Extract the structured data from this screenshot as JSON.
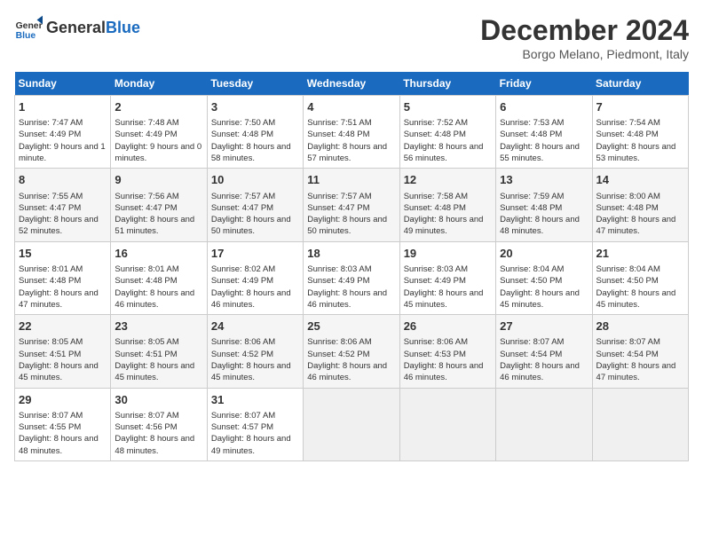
{
  "header": {
    "logo_general": "General",
    "logo_blue": "Blue",
    "month_title": "December 2024",
    "location": "Borgo Melano, Piedmont, Italy"
  },
  "weekdays": [
    "Sunday",
    "Monday",
    "Tuesday",
    "Wednesday",
    "Thursday",
    "Friday",
    "Saturday"
  ],
  "weeks": [
    [
      {
        "day": "1",
        "info": "Sunrise: 7:47 AM\nSunset: 4:49 PM\nDaylight: 9 hours and 1 minute."
      },
      {
        "day": "2",
        "info": "Sunrise: 7:48 AM\nSunset: 4:49 PM\nDaylight: 9 hours and 0 minutes."
      },
      {
        "day": "3",
        "info": "Sunrise: 7:50 AM\nSunset: 4:48 PM\nDaylight: 8 hours and 58 minutes."
      },
      {
        "day": "4",
        "info": "Sunrise: 7:51 AM\nSunset: 4:48 PM\nDaylight: 8 hours and 57 minutes."
      },
      {
        "day": "5",
        "info": "Sunrise: 7:52 AM\nSunset: 4:48 PM\nDaylight: 8 hours and 56 minutes."
      },
      {
        "day": "6",
        "info": "Sunrise: 7:53 AM\nSunset: 4:48 PM\nDaylight: 8 hours and 55 minutes."
      },
      {
        "day": "7",
        "info": "Sunrise: 7:54 AM\nSunset: 4:48 PM\nDaylight: 8 hours and 53 minutes."
      }
    ],
    [
      {
        "day": "8",
        "info": "Sunrise: 7:55 AM\nSunset: 4:47 PM\nDaylight: 8 hours and 52 minutes."
      },
      {
        "day": "9",
        "info": "Sunrise: 7:56 AM\nSunset: 4:47 PM\nDaylight: 8 hours and 51 minutes."
      },
      {
        "day": "10",
        "info": "Sunrise: 7:57 AM\nSunset: 4:47 PM\nDaylight: 8 hours and 50 minutes."
      },
      {
        "day": "11",
        "info": "Sunrise: 7:57 AM\nSunset: 4:47 PM\nDaylight: 8 hours and 50 minutes."
      },
      {
        "day": "12",
        "info": "Sunrise: 7:58 AM\nSunset: 4:48 PM\nDaylight: 8 hours and 49 minutes."
      },
      {
        "day": "13",
        "info": "Sunrise: 7:59 AM\nSunset: 4:48 PM\nDaylight: 8 hours and 48 minutes."
      },
      {
        "day": "14",
        "info": "Sunrise: 8:00 AM\nSunset: 4:48 PM\nDaylight: 8 hours and 47 minutes."
      }
    ],
    [
      {
        "day": "15",
        "info": "Sunrise: 8:01 AM\nSunset: 4:48 PM\nDaylight: 8 hours and 47 minutes."
      },
      {
        "day": "16",
        "info": "Sunrise: 8:01 AM\nSunset: 4:48 PM\nDaylight: 8 hours and 46 minutes."
      },
      {
        "day": "17",
        "info": "Sunrise: 8:02 AM\nSunset: 4:49 PM\nDaylight: 8 hours and 46 minutes."
      },
      {
        "day": "18",
        "info": "Sunrise: 8:03 AM\nSunset: 4:49 PM\nDaylight: 8 hours and 46 minutes."
      },
      {
        "day": "19",
        "info": "Sunrise: 8:03 AM\nSunset: 4:49 PM\nDaylight: 8 hours and 45 minutes."
      },
      {
        "day": "20",
        "info": "Sunrise: 8:04 AM\nSunset: 4:50 PM\nDaylight: 8 hours and 45 minutes."
      },
      {
        "day": "21",
        "info": "Sunrise: 8:04 AM\nSunset: 4:50 PM\nDaylight: 8 hours and 45 minutes."
      }
    ],
    [
      {
        "day": "22",
        "info": "Sunrise: 8:05 AM\nSunset: 4:51 PM\nDaylight: 8 hours and 45 minutes."
      },
      {
        "day": "23",
        "info": "Sunrise: 8:05 AM\nSunset: 4:51 PM\nDaylight: 8 hours and 45 minutes."
      },
      {
        "day": "24",
        "info": "Sunrise: 8:06 AM\nSunset: 4:52 PM\nDaylight: 8 hours and 45 minutes."
      },
      {
        "day": "25",
        "info": "Sunrise: 8:06 AM\nSunset: 4:52 PM\nDaylight: 8 hours and 46 minutes."
      },
      {
        "day": "26",
        "info": "Sunrise: 8:06 AM\nSunset: 4:53 PM\nDaylight: 8 hours and 46 minutes."
      },
      {
        "day": "27",
        "info": "Sunrise: 8:07 AM\nSunset: 4:54 PM\nDaylight: 8 hours and 46 minutes."
      },
      {
        "day": "28",
        "info": "Sunrise: 8:07 AM\nSunset: 4:54 PM\nDaylight: 8 hours and 47 minutes."
      }
    ],
    [
      {
        "day": "29",
        "info": "Sunrise: 8:07 AM\nSunset: 4:55 PM\nDaylight: 8 hours and 48 minutes."
      },
      {
        "day": "30",
        "info": "Sunrise: 8:07 AM\nSunset: 4:56 PM\nDaylight: 8 hours and 48 minutes."
      },
      {
        "day": "31",
        "info": "Sunrise: 8:07 AM\nSunset: 4:57 PM\nDaylight: 8 hours and 49 minutes."
      },
      null,
      null,
      null,
      null
    ]
  ]
}
